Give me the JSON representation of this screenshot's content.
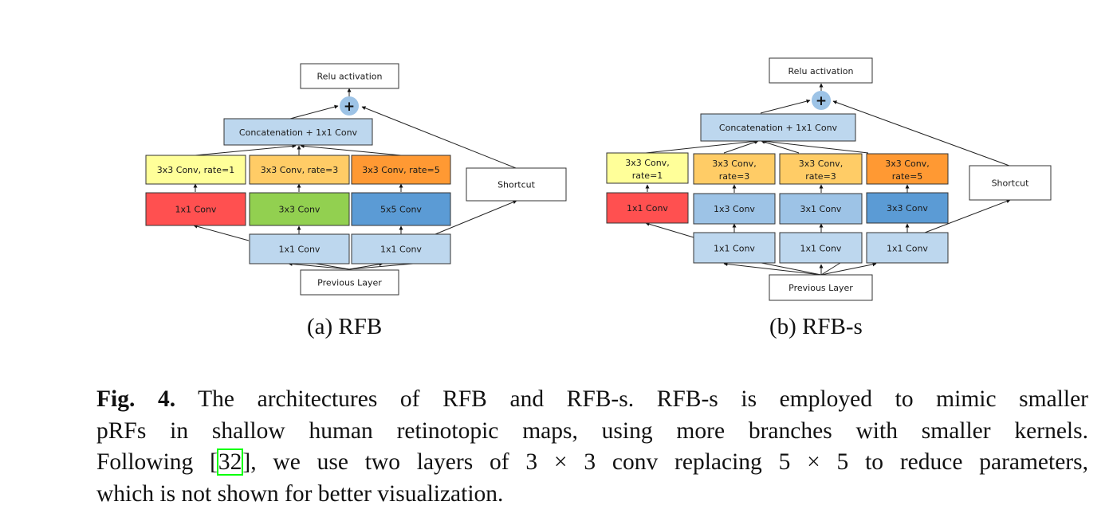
{
  "colors": {
    "yellow": "#ffff99",
    "light_orange": "#ffcc66",
    "orange": "#ff9933",
    "red": "#ff5050",
    "green": "#92d050",
    "dark_blue": "#5b9bd5",
    "mid_blue": "#9dc3e6",
    "light_blue": "#bdd7ee",
    "white": "#ffffff",
    "plus_circle": "#9dc3e6",
    "cite_border": "#00ff00"
  },
  "rfb": {
    "subcaption": "(a) RFB",
    "relu": "Relu activation",
    "plus": "+",
    "concat": "Concatenation + 1x1 Conv",
    "shortcut": "Shortcut",
    "previous": "Previous Layer",
    "dilated": [
      "3x3 Conv, rate=1",
      "3x3 Conv, rate=3",
      "3x3 Conv, rate=5"
    ],
    "branch_convs": [
      "1x1 Conv",
      "3x3 Conv",
      "5x5 Conv"
    ],
    "bottleneck": [
      "1x1 Conv",
      "1x1 Conv"
    ]
  },
  "rfbs": {
    "subcaption": "(b) RFB-s",
    "relu": "Relu activation",
    "plus": "+",
    "concat": "Concatenation + 1x1 Conv",
    "shortcut": "Shortcut",
    "previous": "Previous Layer",
    "dilated": [
      [
        "3x3 Conv,",
        "rate=1"
      ],
      [
        "3x3 Conv,",
        "rate=3"
      ],
      [
        "3x3 Conv,",
        "rate=3"
      ],
      [
        "3x3 Conv,",
        "rate=5"
      ]
    ],
    "branch_convs": [
      "1x1 Conv",
      "1x3 Conv",
      "3x1 Conv",
      "3x3 Conv"
    ],
    "bottleneck": [
      "1x1 Conv",
      "1x1 Conv",
      "1x1 Conv"
    ]
  },
  "caption": {
    "label": "Fig. 4.",
    "line1": " The architectures of RFB and RFB-s. RFB-s is employed to mimic smaller",
    "line2": "pRFs in shallow human retinotopic maps, using more branches with smaller kernels.",
    "line3_pre": "Following [",
    "citation": "32",
    "line3_post": "], we use two layers of 3 × 3 conv replacing 5 × 5 to reduce parameters,",
    "line4": "which is not shown for better visualization."
  }
}
